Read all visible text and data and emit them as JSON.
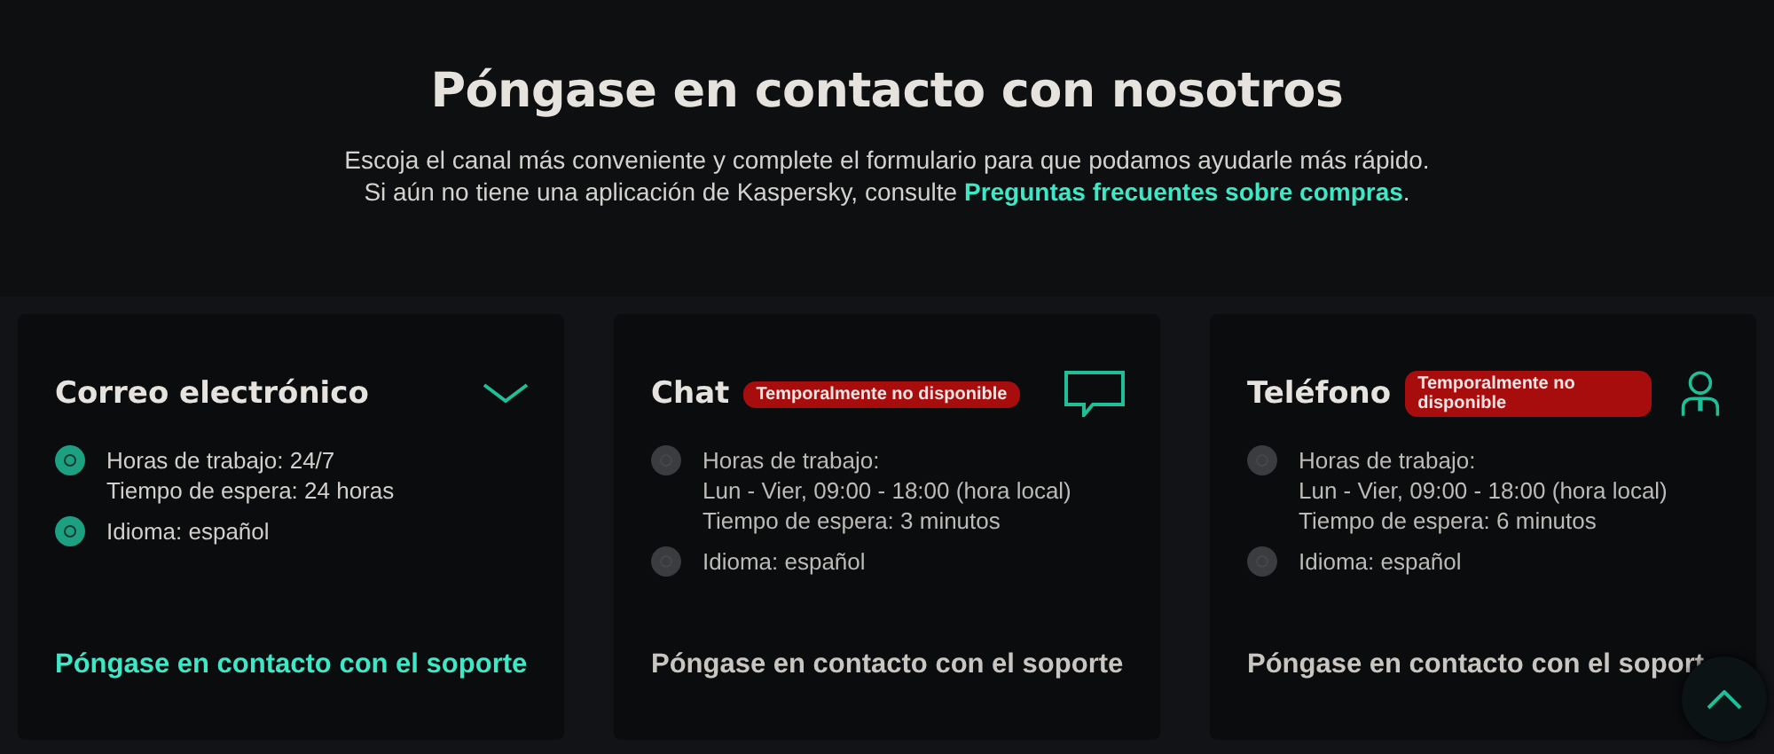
{
  "header": {
    "title": "Póngase en contacto con nosotros",
    "lines": [
      "Escoja el canal más conveniente y complete el formulario para que podamos ayudarle más rápido.",
      "Si aún no tiene una aplicación de Kaspersky, consulte "
    ],
    "link": "Preguntas frecuentes sobre compras",
    "after_link": "."
  },
  "cards": [
    {
      "kind": "email",
      "title": "Correo electrónico",
      "available": true,
      "items": [
        {
          "lines": [
            "Horas de trabajo: 24/7",
            "Tiempo de espera: 24 horas"
          ]
        },
        {
          "lines": [
            "Idioma: español"
          ]
        }
      ],
      "link": "Póngase en contacto con el soporte"
    },
    {
      "kind": "chat",
      "title": "Chat",
      "badge": "Temporalmente no disponible",
      "available": false,
      "items": [
        {
          "lines": [
            "Horas de trabajo:",
            "Lun - Vier, 09:00 - 18:00 (hora local)",
            "Tiempo de espera: 3 minutos"
          ]
        },
        {
          "lines": [
            "Idioma: español"
          ]
        }
      ],
      "link": "Póngase en contacto con el soporte"
    },
    {
      "kind": "phone",
      "title": "Teléfono",
      "badge": "Temporalmente no disponible",
      "available": false,
      "items": [
        {
          "lines": [
            "Horas de trabajo:",
            "Lun - Vier, 09:00 - 18:00 (hora local)",
            "Tiempo de espera: 6 minutos"
          ]
        },
        {
          "lines": [
            "Idioma: español"
          ]
        }
      ],
      "link": "Póngase en contacto con el soport"
    }
  ]
}
